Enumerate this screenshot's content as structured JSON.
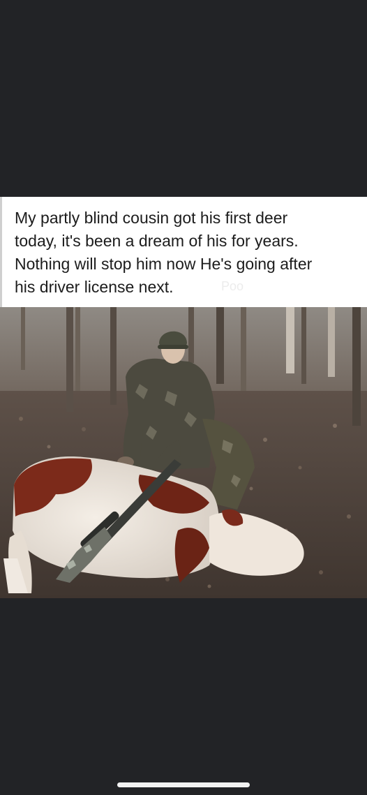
{
  "post": {
    "caption": "My partly blind cousin got his first deer\ntoday, it's been a dream of his for years.\nNothing will stop him now  He's going after\nhis driver license next.",
    "watermark": "Poo"
  },
  "photo": {
    "subject": "hunter in camouflage kneeling beside a cow with a rifle"
  },
  "colors": {
    "background": "#222326",
    "caption_bg": "#ffffff",
    "caption_text": "#1c1c1c",
    "home_indicator": "#f2f2f2"
  }
}
